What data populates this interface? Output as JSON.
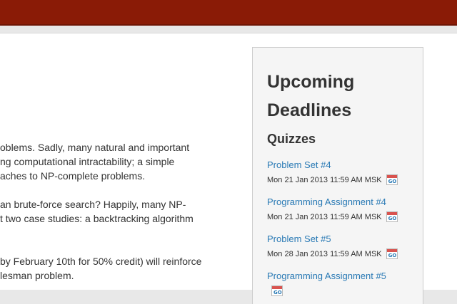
{
  "main": {
    "paragraphs": [
      {
        "lines": [
          "oblems. Sadly, many natural and important",
          "ng computational intractability; a simple",
          "aches to NP-complete problems."
        ]
      },
      {
        "lines": [
          "an brute-force search? Happily, many NP-",
          "t two case studies: a backtracking algorithm",
          ""
        ]
      },
      {
        "lines": [
          "by February 10th for 50% credit) will reinforce",
          "lesman problem."
        ]
      }
    ]
  },
  "sidebar": {
    "title": "Upcoming Deadlines",
    "section": "Quizzes",
    "items": [
      {
        "title": "Problem Set #4",
        "deadline": "Mon 21 Jan 2013 11:59 AM MSK"
      },
      {
        "title": "Programming Assignment #4",
        "deadline": "Mon 21 Jan 2013 11:59 AM MSK"
      },
      {
        "title": "Problem Set #5",
        "deadline": "Mon 28 Jan 2013 11:59 AM MSK"
      },
      {
        "title": "Programming Assignment #5",
        "deadline": ""
      }
    ]
  },
  "icons": {
    "calendar": "google-calendar-icon"
  },
  "colors": {
    "header": "#8a1b06",
    "link": "#2a7ab5"
  }
}
